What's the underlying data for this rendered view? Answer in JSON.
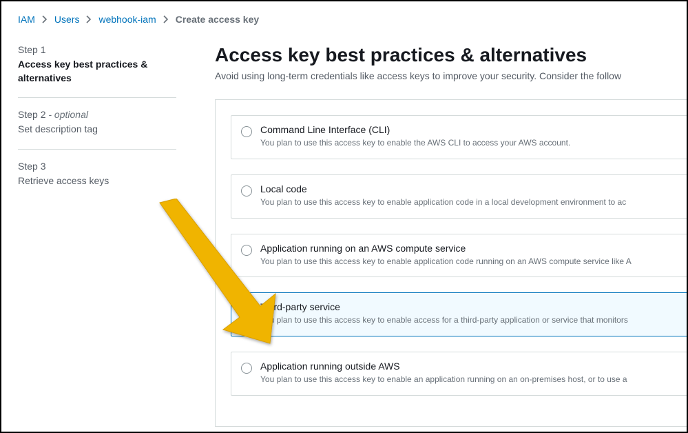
{
  "breadcrumb": {
    "items": [
      {
        "label": "IAM",
        "link": true
      },
      {
        "label": "Users",
        "link": true
      },
      {
        "label": "webhook-iam",
        "link": true
      },
      {
        "label": "Create access key",
        "link": false
      }
    ]
  },
  "steps": [
    {
      "label": "Step 1",
      "optional": "",
      "title": "Access key best practices & alternatives",
      "active": true
    },
    {
      "label": "Step 2",
      "optional": " - optional",
      "title": "Set description tag",
      "active": false
    },
    {
      "label": "Step 3",
      "optional": "",
      "title": "Retrieve access keys",
      "active": false
    }
  ],
  "page": {
    "title": "Access key best practices & alternatives",
    "description": "Avoid using long-term credentials like access keys to improve your security. Consider the follow"
  },
  "options": [
    {
      "title": "Command Line Interface (CLI)",
      "description": "You plan to use this access key to enable the AWS CLI to access your AWS account.",
      "selected": false
    },
    {
      "title": "Local code",
      "description": "You plan to use this access key to enable application code in a local development environment to ac",
      "selected": false
    },
    {
      "title": "Application running on an AWS compute service",
      "description": "You plan to use this access key to enable application code running on an AWS compute service like A",
      "selected": false
    },
    {
      "title": "Third-party service",
      "description": "You plan to use this access key to enable access for a third-party application or service that monitors",
      "selected": true
    },
    {
      "title": "Application running outside AWS",
      "description": "You plan to use this access key to enable an application running on an on-premises host, or to use a",
      "selected": false
    }
  ]
}
